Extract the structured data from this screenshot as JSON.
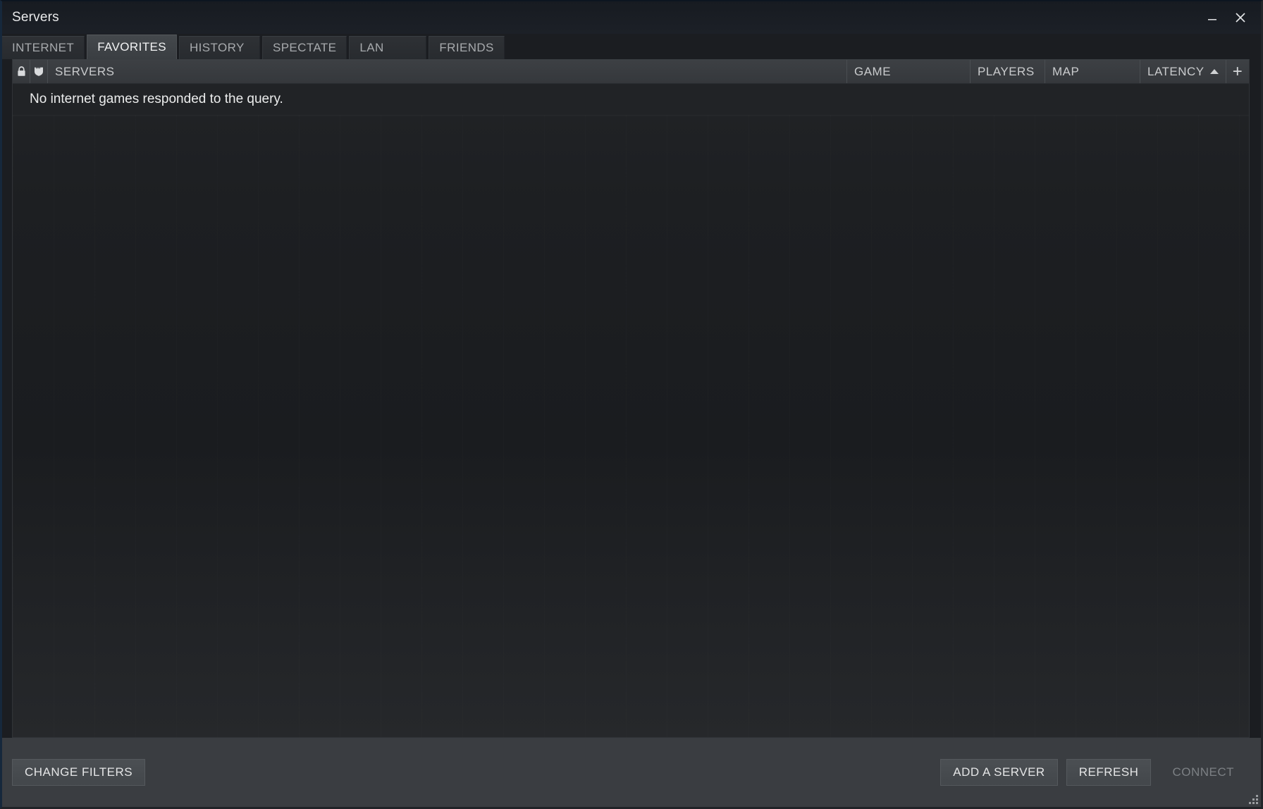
{
  "window": {
    "title": "Servers",
    "minimize_label": "minimize",
    "close_label": "close",
    "resize_grip_label": "resize"
  },
  "tabs": [
    {
      "label": "INTERNET",
      "active": false
    },
    {
      "label": "FAVORITES",
      "active": true
    },
    {
      "label": "HISTORY",
      "active": false
    },
    {
      "label": "SPECTATE",
      "active": false
    },
    {
      "label": "LAN",
      "active": false
    },
    {
      "label": "FRIENDS",
      "active": false
    }
  ],
  "table": {
    "columns": {
      "password_icon": "lock-icon",
      "vac_icon": "shield-icon",
      "servers": "SERVERS",
      "game": "GAME",
      "players": "PLAYERS",
      "map": "MAP",
      "latency": "LATENCY",
      "add_column": "+"
    },
    "sort": {
      "column": "LATENCY",
      "direction": "ascending",
      "glyph": "▲"
    },
    "rows": [],
    "empty_message": "No internet games responded to the query."
  },
  "footer": {
    "change_filters": "CHANGE FILTERS",
    "add_a_server": "ADD A SERVER",
    "refresh": "REFRESH",
    "connect": "CONNECT",
    "connect_disabled": true
  },
  "colors": {
    "window_bg": "#1b1d21",
    "titlebar_bg": "#171b21",
    "tab_active": "#44484c",
    "tab_inactive": "#2e3135",
    "header_bg": "#3d4044",
    "list_bg": "#1a1c1f",
    "footer_bg": "#3a3d41",
    "text_primary": "#eceded",
    "text_secondary": "#a7aaad",
    "text_disabled": "#7c8084",
    "border_accent": "#16283c"
  }
}
